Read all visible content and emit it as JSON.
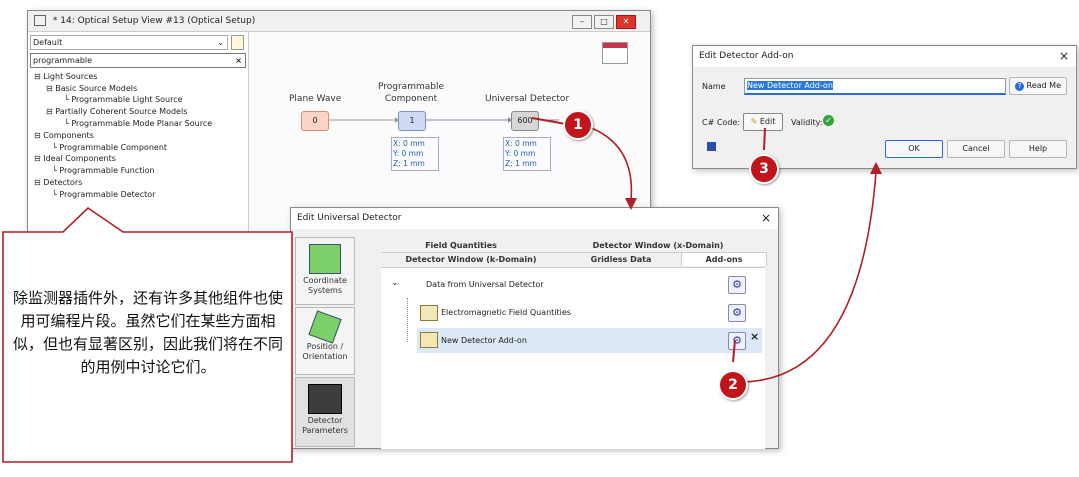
{
  "optical_setup_window": {
    "title": "* 14: Optical Setup View #13 (Optical Setup)",
    "profile_value": "Default",
    "search_value": "programmable",
    "tree": [
      {
        "label": "Light Sources",
        "level": 0
      },
      {
        "label": "Basic Source Models",
        "level": 1
      },
      {
        "label": "Programmable Light Source",
        "level": 2
      },
      {
        "label": "Partially Coherent Source Models",
        "level": 1
      },
      {
        "label": "Programmable Mode Planar Source",
        "level": 2
      },
      {
        "label": "Components",
        "level": 0
      },
      {
        "label": "Programmable Component",
        "level": 1
      },
      {
        "label": "Ideal Components",
        "level": 0
      },
      {
        "label": "Programmable Function",
        "level": 1
      },
      {
        "label": "Detectors",
        "level": 0
      },
      {
        "label": "Programmable Detector",
        "level": 1
      }
    ],
    "nodes": {
      "plane_wave": {
        "label": "Plane Wave",
        "index": "0"
      },
      "programmable_component": {
        "label": "Programmable Component",
        "index": "1",
        "coords": [
          "X: 0 mm",
          "Y: 0 mm",
          "Z: 1 mm"
        ]
      },
      "universal_detector": {
        "label": "Universal Detector",
        "index": "600",
        "coords": [
          "X: 0 mm",
          "Y: 0 mm",
          "Z: 1 mm"
        ]
      }
    }
  },
  "edit_universal_detector": {
    "title": "Edit Universal Detector",
    "side": {
      "coordinate_systems": "Coordinate Systems",
      "position_orientation": "Position / Orientation",
      "detector_parameters": "Detector Parameters"
    },
    "tabs_row1": [
      "Field Quantities",
      "Detector Window (x-Domain)"
    ],
    "tabs_row2": [
      "Detector Window (k-Domain)",
      "Gridless Data",
      "Add-ons"
    ],
    "group_label": "Data from Universal Detector",
    "items": [
      "Electromagnetic Field Quantities",
      "New Detector Add-on"
    ],
    "close_glyph": "×"
  },
  "edit_detector_addon": {
    "title": "Edit Detector Add-on",
    "name_label": "Name",
    "name_value": "New Detector Add-on",
    "read_me": "Read Me",
    "code_label": "C# Code:",
    "edit_label": "Edit",
    "validity_label": "Validity:",
    "ok": "OK",
    "cancel": "Cancel",
    "help": "Help"
  },
  "callout": {
    "text": "除监测器插件外，还有许多其他组件也使用可编程片段。虽然它们在某些方面相似，但也有显著区别，因此我们将在不同的用例中讨论它们。"
  },
  "badges": [
    "1",
    "2",
    "3"
  ],
  "colors": {
    "accent": "#c0151b",
    "link": "#1f5fbf",
    "selection": "#dde8f7"
  }
}
